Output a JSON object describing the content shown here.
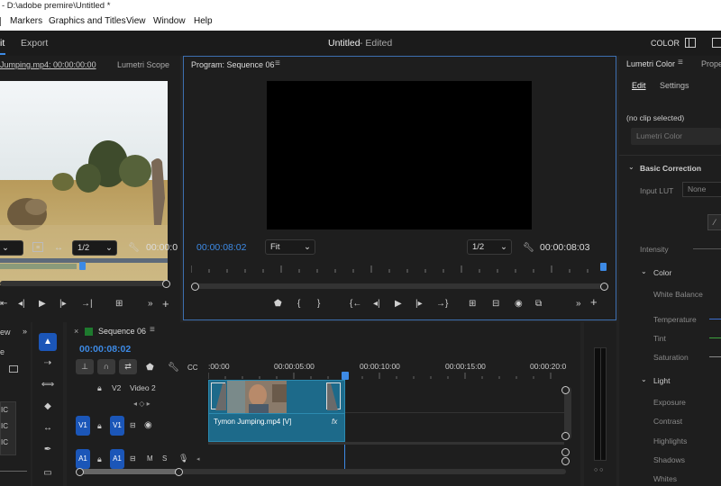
{
  "window": {
    "title": "- D:\\adobe premire\\Untitled *"
  },
  "menu": [
    "Markers",
    "Graphics and Titles",
    "View",
    "Window",
    "Help"
  ],
  "header": {
    "edit_tab": "it",
    "export_tab": "Export",
    "project_title": "Untitled",
    "status": "- Edited",
    "workspace_label": "COLOR"
  },
  "source_panel": {
    "tab": "Jumping.mp4: 00:00:00:00",
    "tab2": "Lumetri Scope",
    "resolution": "1/2",
    "timecode": "00:00:0"
  },
  "program_panel": {
    "tab": "Program: Sequence 06",
    "current_timecode": "00:00:08:02",
    "fit": "Fit",
    "resolution": "1/2",
    "duration": "00:00:08:03"
  },
  "lumetri": {
    "tab": "Lumetri Color",
    "tab2": "Prope",
    "subtab_edit": "Edit",
    "subtab_settings": "Settings",
    "no_clip": "(no clip selected)",
    "clip_select": "Lumetri Color",
    "basic_correction": "Basic Correction",
    "input_lut_label": "Input LUT",
    "input_lut_value": "None",
    "intensity": "Intensity",
    "color_section": "Color",
    "white_balance": "White Balance",
    "temperature": "Temperature",
    "tint": "Tint",
    "saturation": "Saturation",
    "light_section": "Light",
    "exposure": "Exposure",
    "contrast": "Contrast",
    "highlights": "Highlights",
    "shadows": "Shadows",
    "whites": "Whites"
  },
  "timeline": {
    "tab": "Sequence 06",
    "timecode": "00:00:08:02",
    "ruler": [
      ":00:00",
      "00:00:05:00",
      "00:00:10:00",
      "00:00:15:00",
      "00:00:20:0"
    ],
    "v2_label": "V2",
    "v2_name": "Video 2",
    "v1_label": "V1",
    "v1_src": "V1",
    "a1_label": "A1",
    "a1_src": "A1",
    "m_label": "M",
    "s_label": "S",
    "clip_name": "Tymon Jumping.mp4 [V]",
    "fx": "fx"
  },
  "project_panel": {
    "tab": "ew",
    "item": "e",
    "rows": [
      "IC",
      "IC",
      "IC"
    ]
  },
  "colors": {
    "accent": "#3d8ae5",
    "clip": "#1d6a8a",
    "track_button": "#1b56b8",
    "playhead": "#3d8ae5"
  }
}
